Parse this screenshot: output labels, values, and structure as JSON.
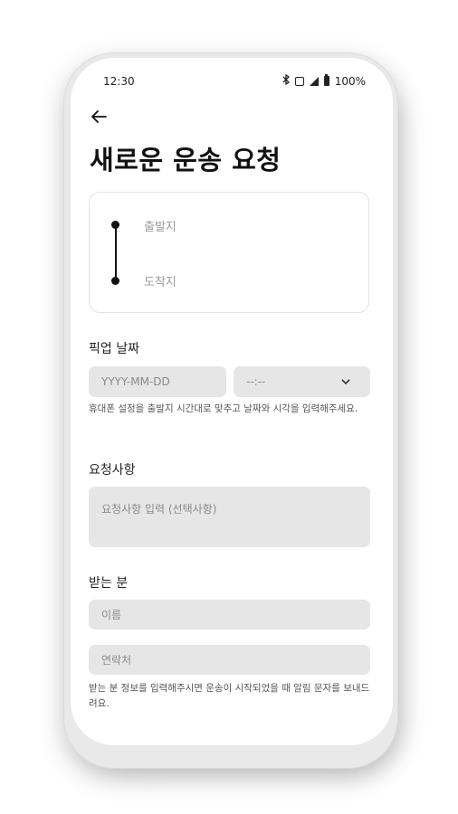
{
  "status_bar": {
    "time": "12:30",
    "battery": "100%",
    "icons": [
      "bluetooth-icon",
      "vibrate-icon",
      "signal-icon",
      "battery-icon"
    ]
  },
  "header": {
    "back_icon": "arrow-left-icon",
    "title": "새로운 운송 요청"
  },
  "route": {
    "origin_placeholder": "출발지",
    "destination_placeholder": "도착지"
  },
  "pickup": {
    "label": "픽업 날짜",
    "date_placeholder": "YYYY-MM-DD",
    "time_placeholder": "--:--",
    "helper": "휴대폰 설정을 출발지 시간대로 맞추고 날짜와 시각을 입력해주세요."
  },
  "request": {
    "label": "요청사항",
    "placeholder": "요청사항 입력 (선택사항)"
  },
  "recipient": {
    "label": "받는 분",
    "name_placeholder": "이름",
    "contact_placeholder": "연락처",
    "helper": "받는 분 정보를 입력해주시면 운송이 시작되었을 때 알림 문자를 보내드려요."
  }
}
